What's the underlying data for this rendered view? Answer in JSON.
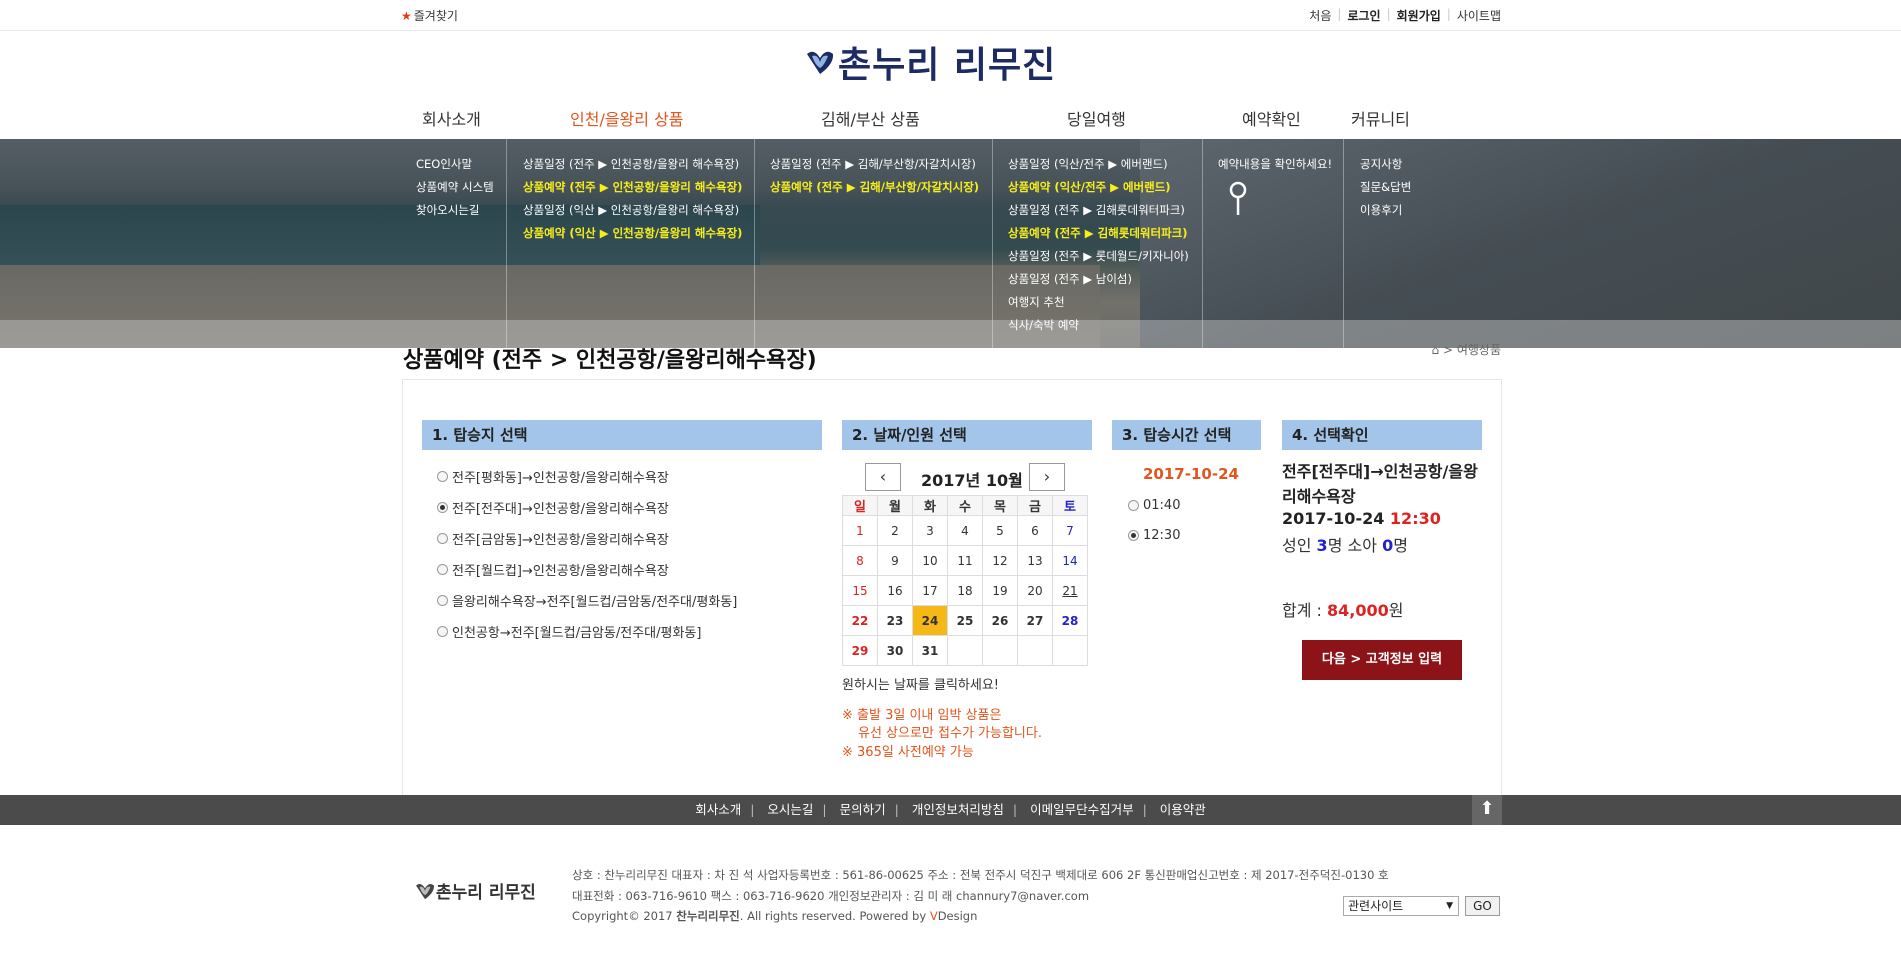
{
  "topbar": {
    "favorites": "즐겨찾기",
    "links": [
      "처음",
      "로그인",
      "회원가입",
      "사이트맵"
    ]
  },
  "logo": {
    "text": "촌누리 리무진"
  },
  "nav": [
    {
      "label": "회사소개",
      "active": false
    },
    {
      "label": "인천/을왕리 상품",
      "active": true
    },
    {
      "label": "김해/부산 상품",
      "active": false
    },
    {
      "label": "당일여행",
      "active": false
    },
    {
      "label": "예약확인",
      "active": false
    },
    {
      "label": "커뮤니티",
      "active": false
    }
  ],
  "submenus": {
    "company": [
      "CEO인사말",
      "상품예약 시스템",
      "찾아오시는길"
    ],
    "incheon": [
      "상품일정 (전주 ▶ 인천공항/을왕리 해수욕장)",
      "상품예약 (전주 ▶ 인천공항/을왕리 해수욕장)",
      "상품일정 (익산 ▶ 인천공항/을왕리 해수욕장)",
      "상품예약 (익산 ▶ 인천공항/을왕리 해수욕장)"
    ],
    "gimhae": [
      "상품일정 (전주 ▶ 김해/부산항/자갈치시장)",
      "상품예약 (전주 ▶ 김해/부산항/자갈치시장)"
    ],
    "daytrip": [
      "상품일정 (익산/전주 ▶ 에버랜드)",
      "상품예약 (익산/전주 ▶ 에버랜드)",
      "상품일정 (전주 ▶ 김해롯데워터파크)",
      "상품예약 (전주 ▶ 김해롯데워터파크)",
      "상품일정 (전주 ▶ 롯데월드/키자니아)",
      "상품일정 (전주 ▶ 남이섬)",
      "여행지 추천",
      "식사/숙박 예약"
    ],
    "reservation": [
      "예약내용을 확인하세요!"
    ],
    "community": [
      "공지사항",
      "질문&답변",
      "이용후기"
    ]
  },
  "page": {
    "title": "상품예약 (전주 > 인천공항/을왕리해수욕장)",
    "breadcrumb": "> 여행상품"
  },
  "step1": {
    "header": "1. 탑승지 선택",
    "options": [
      {
        "label": "전주[평화동]→인천공항/을왕리해수욕장",
        "checked": false
      },
      {
        "label": "전주[전주대]→인천공항/을왕리해수욕장",
        "checked": true
      },
      {
        "label": "전주[금암동]→인천공항/을왕리해수욕장",
        "checked": false
      },
      {
        "label": "전주[월드컵]→인천공항/을왕리해수욕장",
        "checked": false
      },
      {
        "label": "을왕리해수욕장→전주[월드컵/금암동/전주대/평화동]",
        "checked": false
      },
      {
        "label": "인천공항→전주[월드컵/금암동/전주대/평화동]",
        "checked": false
      }
    ]
  },
  "step2": {
    "header": "2. 날짜/인원 선택",
    "prev": "‹",
    "next": "›",
    "month": "2017년 10월",
    "weekdays": [
      "일",
      "월",
      "화",
      "수",
      "목",
      "금",
      "토"
    ],
    "weeks": [
      [
        "1",
        "2",
        "3",
        "4",
        "5",
        "6",
        "7"
      ],
      [
        "8",
        "9",
        "10",
        "11",
        "12",
        "13",
        "14"
      ],
      [
        "15",
        "16",
        "17",
        "18",
        "19",
        "20",
        "21"
      ],
      [
        "22",
        "23",
        "24",
        "25",
        "26",
        "27",
        "28"
      ],
      [
        "29",
        "30",
        "31",
        "",
        "",
        "",
        ""
      ]
    ],
    "selected_day": "24",
    "hint": "원하시는 날짜를 클릭하세요!",
    "notes": [
      "※ 출발 3일 이내 임박 상품은",
      "유선 상으로만 접수가 가능합니다.",
      "※ 365일 사전예약 가능"
    ]
  },
  "step3": {
    "header": "3. 탑승시간 선택",
    "date": "2017-10-24",
    "times": [
      {
        "label": "01:40",
        "checked": false
      },
      {
        "label": "12:30",
        "checked": true
      }
    ]
  },
  "step4": {
    "header": "4. 선택확인",
    "route": "전주[전주대]→인천공항/을왕리해수욕장",
    "date": "2017-10-24",
    "time": "12:30",
    "adult_label": "성인",
    "adult_count": "3",
    "adult_unit": "명",
    "child_label": "소아",
    "child_count": "0",
    "child_unit": "명",
    "total_label": "합계 :",
    "total_value": "84,000",
    "total_unit": "원",
    "next_button": "다음 > 고객정보 입력"
  },
  "footer": {
    "links": [
      "회사소개",
      "오시는길",
      "문의하기",
      "개인정보처리방침",
      "이메일무단수집거부",
      "이용약관"
    ],
    "logo": "촌누리 리무진",
    "info1": "상호 : 찬누리리무진 대표자 : 차 진 석 사업자등록번호 : 561-86-00625 주소 : 전북 전주시 덕진구 백제대로 606 2F 통신판매업신고번호 : 제 2017-전주덕진-0130 호",
    "info2": "대표전화 : 063-716-9610 팩스 : 063-716-9620 개인정보관리자 : 김 미 래 channury7@naver.com",
    "copyright_prefix": "Copyright© 2017",
    "copyright_company": "찬누리리무진",
    "copyright_suffix": ". All rights reserved. Powered by",
    "powered": "V",
    "powered_rest": "Design",
    "related_site": "관련사이트",
    "go": "GO"
  }
}
